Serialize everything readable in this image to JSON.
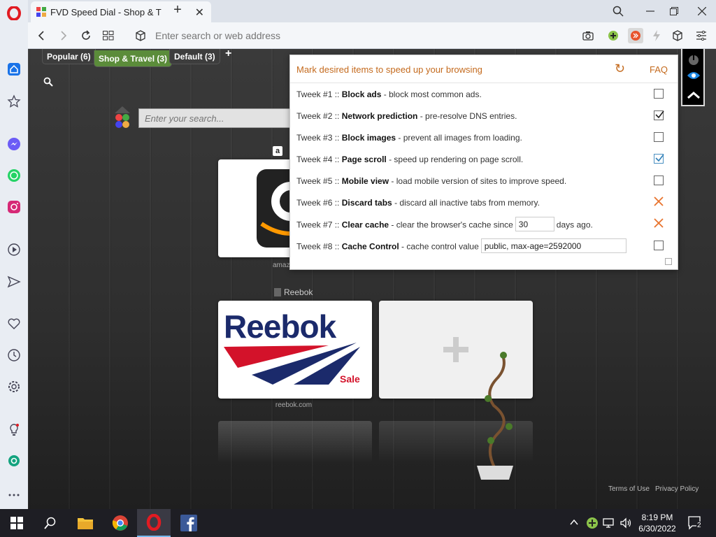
{
  "browser": {
    "tab_title": "FVD Speed Dial - Shop & T",
    "address_placeholder": "Enter search or web address"
  },
  "speed_dial": {
    "groups": [
      {
        "label": "Popular (6)"
      },
      {
        "label": "Shop & Travel (3)"
      },
      {
        "label": "Default (3)"
      }
    ],
    "search_placeholder": "Enter your search...",
    "dials": [
      {
        "title": "amazon",
        "caption": "amaz"
      },
      {
        "title": "Reebok",
        "caption": "reebok.com",
        "logo_text": "Reebok",
        "sale_text": "Sale"
      }
    ],
    "reebok_label": "Reebok",
    "footer": {
      "terms": "Terms of Use",
      "privacy": "Privacy Policy"
    }
  },
  "popup": {
    "title": "Mark desired items to speed up your browsing",
    "faq": "FAQ",
    "tweaks": [
      {
        "prefix": "Tweek #1 :: ",
        "name": "Block ads",
        "desc": " - block most common ads.",
        "state": "unchecked"
      },
      {
        "prefix": "Tweek #2 :: ",
        "name": "Network prediction",
        "desc": " - pre-resolve DNS entries.",
        "state": "checked"
      },
      {
        "prefix": "Tweek #3 :: ",
        "name": "Block images",
        "desc": " - prevent all images from loading.",
        "state": "unchecked"
      },
      {
        "prefix": "Tweek #4 :: ",
        "name": "Page scroll",
        "desc": " - speed up rendering on page scroll.",
        "state": "checked-blue"
      },
      {
        "prefix": "Tweek #5 :: ",
        "name": "Mobile view",
        "desc": " - load mobile version of sites to improve speed.",
        "state": "unchecked"
      },
      {
        "prefix": "Tweek #6 :: ",
        "name": "Discard tabs",
        "desc": " - discard all inactive tabs from memory.",
        "state": "x"
      },
      {
        "prefix": "Tweek #7 :: ",
        "name": "Clear cache",
        "desc": " - clear the browser's cache since",
        "input_value": "30",
        "suffix": "days ago.",
        "state": "x"
      },
      {
        "prefix": "Tweek #8 :: ",
        "name": "Cache Control",
        "desc": " - cache control value",
        "input_value": "public, max-age=2592000",
        "state": "unchecked"
      }
    ]
  },
  "taskbar": {
    "time": "8:19 PM",
    "date": "6/30/2022",
    "notification_count": "2"
  },
  "colors": {
    "accent_orange": "#c46a1d",
    "opera_red": "#e11b22",
    "group_active": "#5b8c3a"
  }
}
